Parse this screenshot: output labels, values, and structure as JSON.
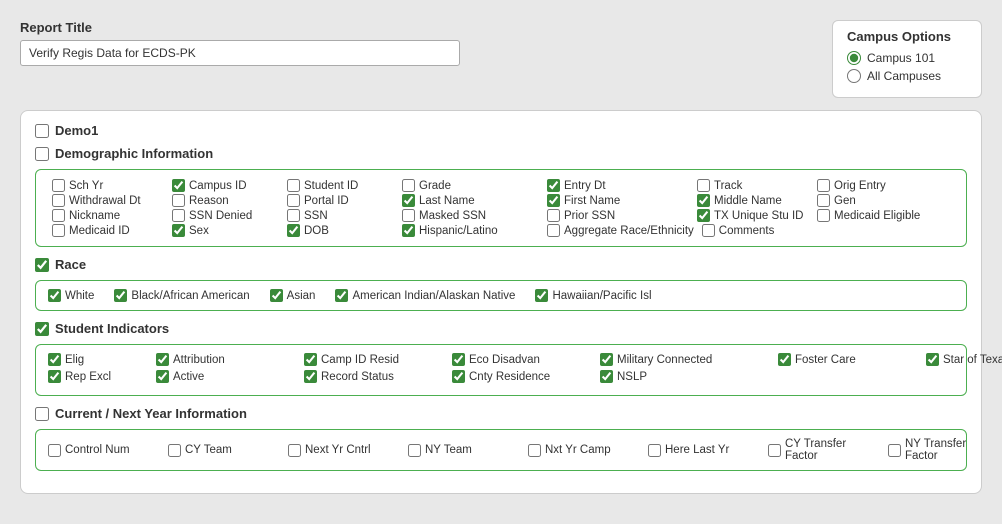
{
  "header": {
    "report_title_label": "Report Title",
    "report_title_value": "Verify Regis Data for ECDS-PK"
  },
  "campus_options": {
    "title": "Campus Options",
    "options": [
      {
        "label": "Campus 101",
        "checked": true
      },
      {
        "label": "All Campuses",
        "checked": false
      }
    ]
  },
  "demo1": {
    "label": "Demo1",
    "checked": false
  },
  "demographic": {
    "label": "Demographic Information",
    "checked": false,
    "rows": [
      [
        {
          "label": "Sch Yr",
          "checked": false
        },
        {
          "label": "Campus ID",
          "checked": true
        },
        {
          "label": "Student ID",
          "checked": false
        },
        {
          "label": "Grade",
          "checked": false
        },
        {
          "label": "Entry Dt",
          "checked": true
        },
        {
          "label": "Track",
          "checked": false
        },
        {
          "label": "Orig Entry",
          "checked": false
        }
      ],
      [
        {
          "label": "Withdrawal Dt",
          "checked": false
        },
        {
          "label": "Reason",
          "checked": false
        },
        {
          "label": "Portal ID",
          "checked": false
        },
        {
          "label": "Last Name",
          "checked": true
        },
        {
          "label": "First Name",
          "checked": true
        },
        {
          "label": "Middle Name",
          "checked": true
        },
        {
          "label": "Gen",
          "checked": false
        }
      ],
      [
        {
          "label": "Nickname",
          "checked": false
        },
        {
          "label": "SSN Denied",
          "checked": false
        },
        {
          "label": "SSN",
          "checked": false
        },
        {
          "label": "Masked SSN",
          "checked": false
        },
        {
          "label": "Prior SSN",
          "checked": false
        },
        {
          "label": "TX Unique Stu ID",
          "checked": true
        },
        {
          "label": "Medicaid Eligible",
          "checked": false
        }
      ],
      [
        {
          "label": "Medicaid ID",
          "checked": false
        },
        {
          "label": "Sex",
          "checked": true
        },
        {
          "label": "DOB",
          "checked": true
        },
        {
          "label": "Hispanic/Latino",
          "checked": true
        },
        {
          "label": "Aggregate Race/Ethnicity",
          "checked": false
        },
        {
          "label": "Comments",
          "checked": false
        },
        {
          "label": "",
          "checked": false,
          "hidden": true
        }
      ]
    ]
  },
  "race": {
    "label": "Race",
    "checked": true,
    "items": [
      {
        "label": "White",
        "checked": true
      },
      {
        "label": "Black/African American",
        "checked": true
      },
      {
        "label": "Asian",
        "checked": true
      },
      {
        "label": "American Indian/Alaskan Native",
        "checked": true
      },
      {
        "label": "Hawaiian/Pacific Isl",
        "checked": true
      }
    ]
  },
  "student_indicators": {
    "label": "Student Indicators",
    "checked": true,
    "rows": [
      [
        {
          "label": "Elig",
          "checked": true
        },
        {
          "label": "Attribution",
          "checked": true
        },
        {
          "label": "Camp ID Resid",
          "checked": true
        },
        {
          "label": "Eco Disadvan",
          "checked": true
        },
        {
          "label": "Military Connected",
          "checked": true
        },
        {
          "label": "Foster Care",
          "checked": true
        },
        {
          "label": "Star of Texas Award",
          "checked": true
        }
      ],
      [
        {
          "label": "Rep Excl",
          "checked": true
        },
        {
          "label": "Active",
          "checked": true
        },
        {
          "label": "Record Status",
          "checked": true
        },
        {
          "label": "Cnty Residence",
          "checked": true
        },
        {
          "label": "NSLP",
          "checked": true
        }
      ]
    ]
  },
  "current_next_year": {
    "label": "Current / Next Year Information",
    "checked": false,
    "items": [
      {
        "label": "Control Num",
        "checked": false
      },
      {
        "label": "CY Team",
        "checked": false
      },
      {
        "label": "Next Yr Cntrl",
        "checked": false
      },
      {
        "label": "NY Team",
        "checked": false
      },
      {
        "label": "Nxt Yr Camp",
        "checked": false
      },
      {
        "label": "Here Last Yr",
        "checked": false
      },
      {
        "label": "CY Transfer Factor",
        "checked": false
      },
      {
        "label": "NY Transfer Factor",
        "checked": false
      }
    ]
  }
}
